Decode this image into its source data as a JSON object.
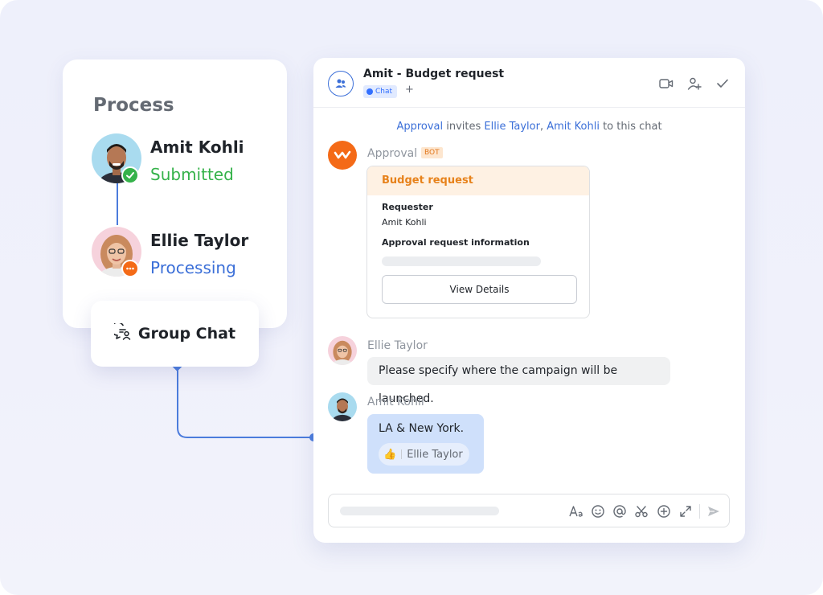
{
  "process": {
    "title": "Process",
    "steps": [
      {
        "name": "Amit Kohli",
        "status": "Submitted",
        "status_color": "#35b24a",
        "badge": "check-icon"
      },
      {
        "name": "Ellie Taylor",
        "status": "Processing",
        "status_color": "#3b6fd8",
        "badge": "more-icon"
      }
    ]
  },
  "group_chat": {
    "label": "Group Chat"
  },
  "chat": {
    "title": "Amit - Budget request",
    "tag": "Chat",
    "add_tab": "+",
    "system": {
      "actor": "Approval",
      "verb": " invites ",
      "invitee1": "Ellie Taylor",
      "comma": ", ",
      "invitee2": "Amit Kohli",
      "suffix": " to this chat"
    },
    "bot": {
      "name": "Approval",
      "badge": "BOT",
      "card": {
        "title": "Budget request",
        "requester_label": "Requester",
        "requester_value": "Amit Kohli",
        "info_label": "Approval request information",
        "button": "View Details"
      }
    },
    "messages": [
      {
        "sender": "Ellie Taylor",
        "text": "Please specify where the campaign will be launched."
      },
      {
        "sender": "Amit Kohli",
        "text": "LA & New York.",
        "reaction": {
          "emoji": "👍",
          "by": "Ellie Taylor"
        }
      }
    ]
  },
  "colors": {
    "accent": "#3b6fd8",
    "bot": "#f46a17",
    "success": "#35b24a",
    "processing_badge": "#f46a17"
  }
}
